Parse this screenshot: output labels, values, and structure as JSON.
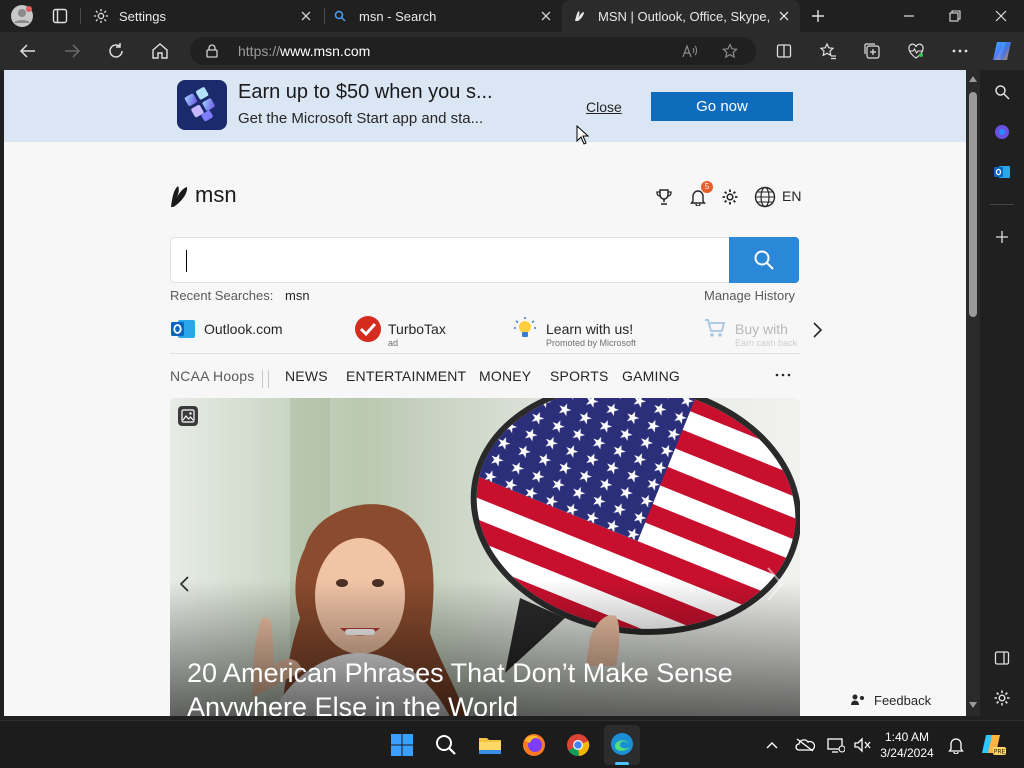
{
  "tabs": [
    {
      "title": "Settings",
      "icon": "gear-icon"
    },
    {
      "title": "msn - Search",
      "icon": "search-icon"
    },
    {
      "title": "MSN | Outlook, Office, Skype, Bing",
      "icon": "msn-icon",
      "active": true
    }
  ],
  "address": {
    "scheme": "https://",
    "host": "www.msn.com"
  },
  "banner": {
    "title": "Earn up to $50 when you s...",
    "subtitle": "Get the Microsoft Start app and sta...",
    "close_label": "Close",
    "cta_label": "Go now"
  },
  "header": {
    "logo_text": "msn",
    "notification_count": "5",
    "language": "EN"
  },
  "search": {
    "recent_label": "Recent Searches:",
    "recent_term": "msn",
    "manage_label": "Manage History"
  },
  "quick_links": [
    {
      "label": "Outlook.com",
      "sub": ""
    },
    {
      "label": "TurboTax",
      "sub": "ad"
    },
    {
      "label": "Learn with us!",
      "sub": "Promoted by Microsoft"
    },
    {
      "label": "Buy with",
      "sub": "Earn cash back"
    }
  ],
  "nav": {
    "first": "NCAA Hoops",
    "items": [
      "NEWS",
      "ENTERTAINMENT",
      "MONEY",
      "SPORTS",
      "GAMING"
    ]
  },
  "hero": {
    "headline_line1": "20 American Phrases That Don’t Make Sense",
    "headline_line2": "Anywhere Else in the World"
  },
  "feedback_label": "Feedback",
  "clock": {
    "time": "1:40 AM",
    "date": "3/24/2024"
  },
  "colors": {
    "accent": "#0f6cbd",
    "banner_bg": "#dbe6f5",
    "search_button": "#2b88d8"
  }
}
